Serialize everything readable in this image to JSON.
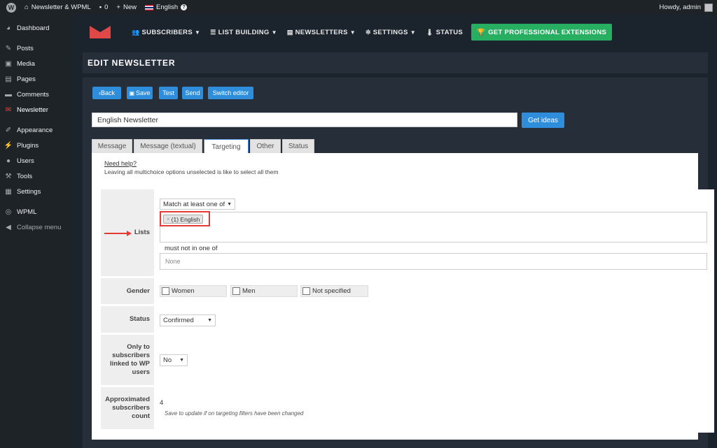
{
  "adminbar": {
    "site_name": "Newsletter & WPML",
    "comments_count": "0",
    "new_label": "New",
    "language": "English",
    "howdy": "Howdy, admin"
  },
  "sidebar": {
    "items": [
      {
        "label": "Dashboard",
        "icon": "dashboard-icon"
      },
      {
        "label": "Posts",
        "icon": "pin-icon"
      },
      {
        "label": "Media",
        "icon": "media-icon"
      },
      {
        "label": "Pages",
        "icon": "pages-icon"
      },
      {
        "label": "Comments",
        "icon": "comments-icon"
      },
      {
        "label": "Newsletter",
        "icon": "newsletter-icon"
      },
      {
        "label": "Appearance",
        "icon": "brush-icon"
      },
      {
        "label": "Plugins",
        "icon": "plug-icon"
      },
      {
        "label": "Users",
        "icon": "user-icon"
      },
      {
        "label": "Tools",
        "icon": "wrench-icon"
      },
      {
        "label": "Settings",
        "icon": "settings-icon"
      },
      {
        "label": "WPML",
        "icon": "wpml-icon"
      },
      {
        "label": "Collapse menu",
        "icon": "collapse-icon"
      }
    ]
  },
  "plugin_nav": {
    "subscribers": "SUBSCRIBERS",
    "list_building": "LIST BUILDING",
    "newsletters": "NEWSLETTERS",
    "settings": "SETTINGS",
    "status": "STATUS",
    "pro": "GET PROFESSIONAL EXTENSIONS"
  },
  "page": {
    "title": "EDIT NEWSLETTER"
  },
  "toolbar": {
    "back": "Back",
    "save": "Save",
    "test": "Test",
    "send": "Send",
    "switch_editor": "Switch editor"
  },
  "subject": {
    "value": "English Newsletter",
    "ideas": "Get ideas"
  },
  "tabs": [
    "Message",
    "Message (textual)",
    "Targeting",
    "Other",
    "Status"
  ],
  "targeting": {
    "help_link": "Need help?",
    "help_text": "Leaving all multichoice options unselected is like to select all them",
    "lists": {
      "label": "Lists",
      "match": "Match at least one of",
      "selected": "(1) English",
      "not_in_label": "must not in one of",
      "not_in_placeholder": "None"
    },
    "gender": {
      "label": "Gender",
      "options": [
        "Women",
        "Men",
        "Not specified"
      ]
    },
    "status": {
      "label": "Status",
      "value": "Confirmed"
    },
    "wp_users": {
      "label": "Only to subscribers linked to WP users",
      "value": "No"
    },
    "count": {
      "label": "Approximated subscribers count",
      "value": "4",
      "note": "Save to update if on targeting filters have been changed"
    }
  },
  "colors": {
    "accent": "#2f8edb",
    "pro_green": "#27ae60",
    "highlight_red": "#e53935",
    "sidebar_bg": "#1d2327"
  }
}
